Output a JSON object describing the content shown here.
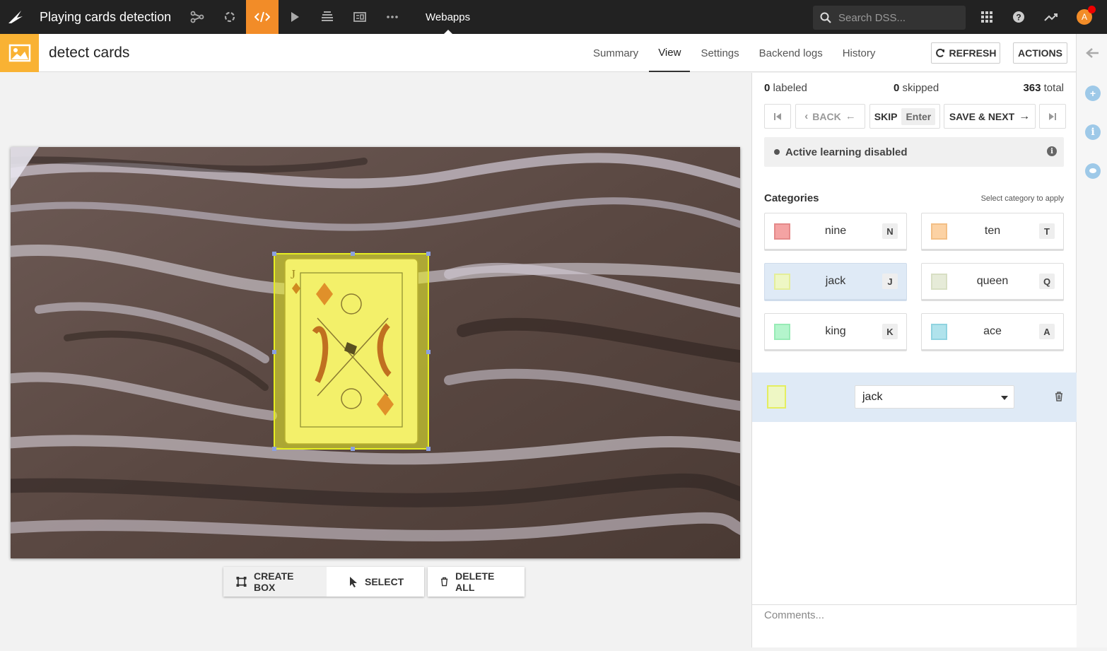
{
  "topbar": {
    "project_title": "Playing cards detection",
    "current_section": "Webapps",
    "search_placeholder": "Search DSS...",
    "avatar_initial": "A",
    "icons": [
      "flow-icon",
      "cycle-icon",
      "code-icon",
      "run-icon",
      "stack-icon",
      "dashboard-icon",
      "more-icon"
    ],
    "accent_color": "#f28c28"
  },
  "header": {
    "object_title": "detect cards",
    "tabs": [
      {
        "label": "Summary"
      },
      {
        "label": "View",
        "active": true
      },
      {
        "label": "Settings"
      },
      {
        "label": "Backend logs"
      },
      {
        "label": "History"
      }
    ],
    "refresh_label": "REFRESH",
    "actions_label": "ACTIONS"
  },
  "toolbar": {
    "create_box_label": "CREATE BOX",
    "select_label": "SELECT",
    "delete_all_label": "DELETE ALL"
  },
  "panel": {
    "labeled_count": "0",
    "labeled_text": "labeled",
    "skipped_count": "0",
    "skipped_text": "skipped",
    "total_count": "363",
    "total_text": "total",
    "back_label": "BACK",
    "skip_label": "SKIP",
    "skip_key": "Enter",
    "save_next_label": "SAVE & NEXT",
    "active_learning_text": "Active learning disabled",
    "categories_title": "Categories",
    "categories_hint": "Select category to apply",
    "categories": [
      {
        "label": "nine",
        "key": "N",
        "color": "#f4a3a3"
      },
      {
        "label": "ten",
        "key": "T",
        "color": "#fcd2a4"
      },
      {
        "label": "jack",
        "key": "J",
        "color": "#eef7c4",
        "selected": true
      },
      {
        "label": "queen",
        "key": "Q",
        "color": "#e6ebd8"
      },
      {
        "label": "king",
        "key": "K",
        "color": "#b4f5cc"
      },
      {
        "label": "ace",
        "key": "A",
        "color": "#b0e3ec"
      }
    ],
    "annotation_category": "jack",
    "comments_placeholder": "Comments..."
  }
}
